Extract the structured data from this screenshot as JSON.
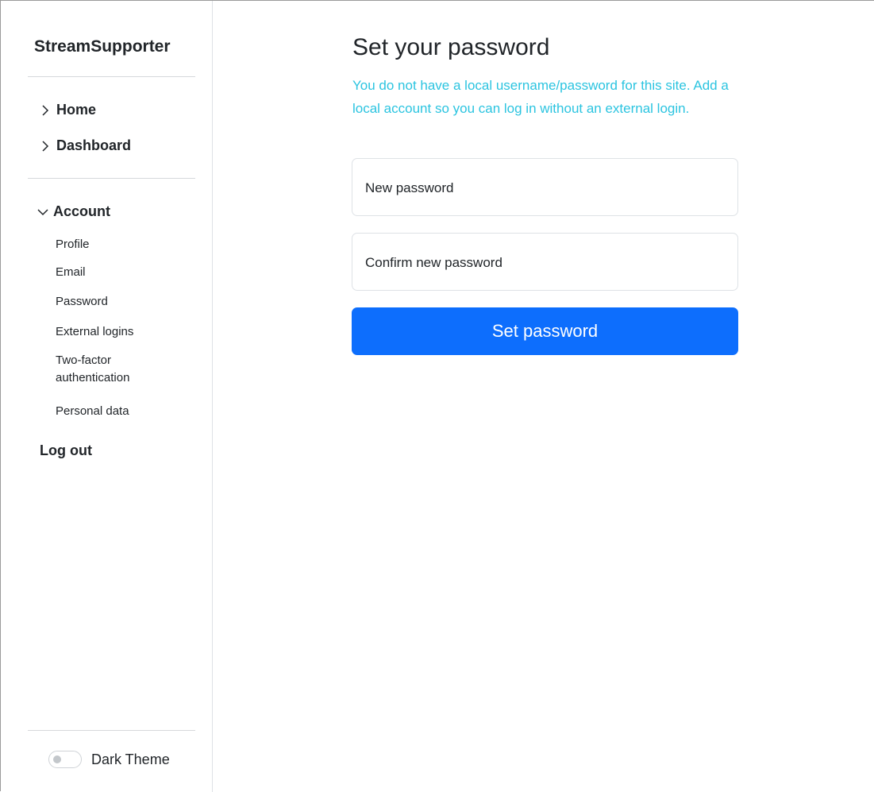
{
  "sidebar": {
    "brand": "StreamSupporter",
    "nav": [
      {
        "label": "Home",
        "icon": "chevron-right-icon"
      },
      {
        "label": "Dashboard",
        "icon": "chevron-right-icon"
      }
    ],
    "account": {
      "label": "Account",
      "icon": "chevron-down-icon",
      "items": [
        "Profile",
        "Email",
        "Password",
        "External logins",
        "Two-factor authentication",
        "Personal data"
      ]
    },
    "logout": "Log out",
    "theme_toggle": {
      "label": "Dark Theme",
      "on": false
    }
  },
  "main": {
    "title": "Set your password",
    "info": "You do not have a local username/password for this site. Add a local account so you can log in without an external login.",
    "fields": [
      {
        "label": "New password"
      },
      {
        "label": "Confirm new password"
      }
    ],
    "submit_label": "Set password"
  },
  "colors": {
    "accent": "#0d6efd",
    "info_text": "#2bc4e0",
    "text": "#212529",
    "border": "#dee2e6"
  }
}
